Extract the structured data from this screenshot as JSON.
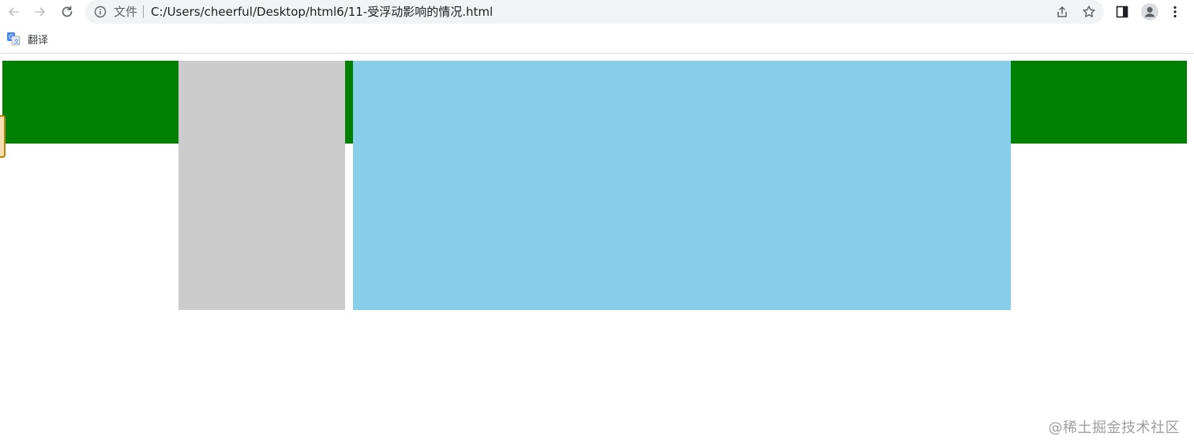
{
  "browser": {
    "address_scheme": "文件",
    "address_url": "C:/Users/cheerful/Desktop/html6/11-受浮动影响的情况.html",
    "bookmark_label": "翻译"
  },
  "page": {
    "colors": {
      "header_bar": "#008000",
      "left_column": "#cccccc",
      "main_column": "#87ceeb",
      "background": "#ffffff"
    },
    "watermark": "@稀土掘金技术社区"
  }
}
